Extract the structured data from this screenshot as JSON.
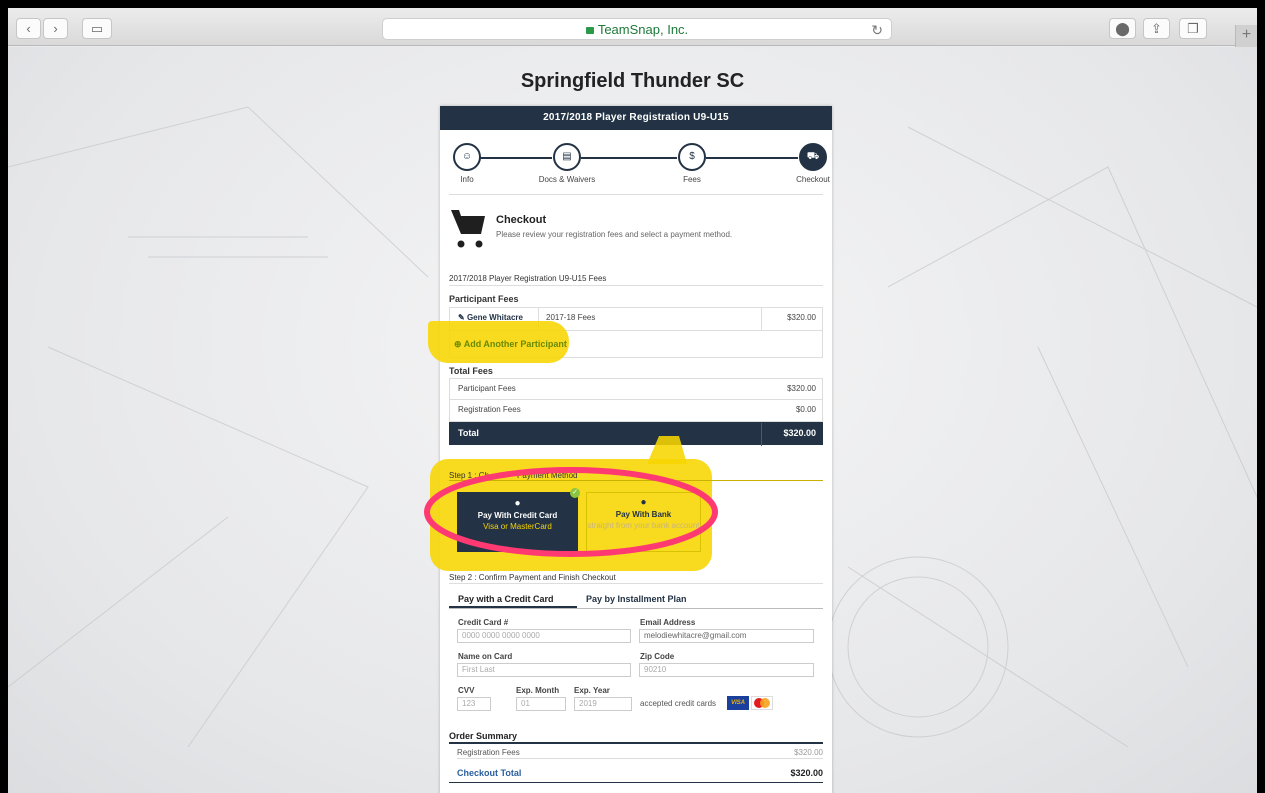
{
  "browser": {
    "url": "TeamSnap, Inc.",
    "reload_icon": "reload-icon",
    "back_icon": "back-icon",
    "forward_icon": "forward-icon",
    "sidebar_icon": "sidebar-icon",
    "download_icon": "download-icon",
    "share_icon": "share-icon",
    "tabs_icon": "tabs-icon",
    "new_tab_label": "+"
  },
  "site": {
    "title": "Springfield Thunder SC"
  },
  "card": {
    "header": "2017/2018 Player Registration U9-U15",
    "steps": [
      {
        "label": "Info",
        "icon": "user-icon"
      },
      {
        "label": "Docs & Waivers",
        "icon": "document-icon"
      },
      {
        "label": "Fees",
        "icon": "money-bag-icon"
      },
      {
        "label": "Checkout",
        "icon": "cart-icon"
      }
    ],
    "checkout": {
      "title": "Checkout",
      "subtitle": "Please review your registration fees and select a payment method."
    },
    "fees_title": "2017/2018 Player Registration U9-U15 Fees",
    "participant_fees": {
      "heading": "Participant Fees",
      "participant": "Gene Whitacre",
      "fee_label": "2017-18 Fees",
      "fee_amount": "$320.00",
      "add_label": "Add Another Participant"
    },
    "total_fees": {
      "heading": "Total Fees",
      "rows": [
        {
          "label": "Participant Fees",
          "amount": "$320.00"
        },
        {
          "label": "Registration Fees",
          "amount": "$0.00"
        }
      ],
      "total_label": "Total",
      "total_amount": "$320.00"
    },
    "step1": {
      "heading_start": "Step 1 : Ch",
      "heading_end": "Payment Method",
      "credit": {
        "title": "Pay With Credit Card",
        "sub": "Visa or MasterCard"
      },
      "bank": {
        "title": "Pay With Bank",
        "sub": "straight from your bank account"
      }
    },
    "step2": {
      "heading": "Step 2 : Confirm Payment and Finish Checkout",
      "tab_credit": "Pay with a Credit Card",
      "tab_installment": "Pay by Installment Plan",
      "cc_label": "Credit Card #",
      "cc_placeholder": "0000 0000 0000 0000",
      "email_label": "Email Address",
      "email_value": "melodiewhitacre@gmail.com",
      "name_label": "Name on Card",
      "name_placeholder": "First Last",
      "zip_label": "Zip Code",
      "zip_placeholder": "90210",
      "cvv_label": "CVV",
      "cvv_placeholder": "123",
      "month_label": "Exp. Month",
      "month_placeholder": "01",
      "year_label": "Exp. Year",
      "year_placeholder": "2019",
      "accepted_label": "accepted credit cards",
      "visa_label": "VISA",
      "mc_label": "MasterCard"
    },
    "order_summary": {
      "heading": "Order Summary",
      "reg_label": "Registration Fees",
      "reg_amount": "$320.00",
      "total_label": "Checkout Total",
      "total_amount": "$320.00"
    }
  },
  "colors": {
    "navy": "#233345",
    "highlight": "#f7d500",
    "annotation": "#ff3a73"
  }
}
